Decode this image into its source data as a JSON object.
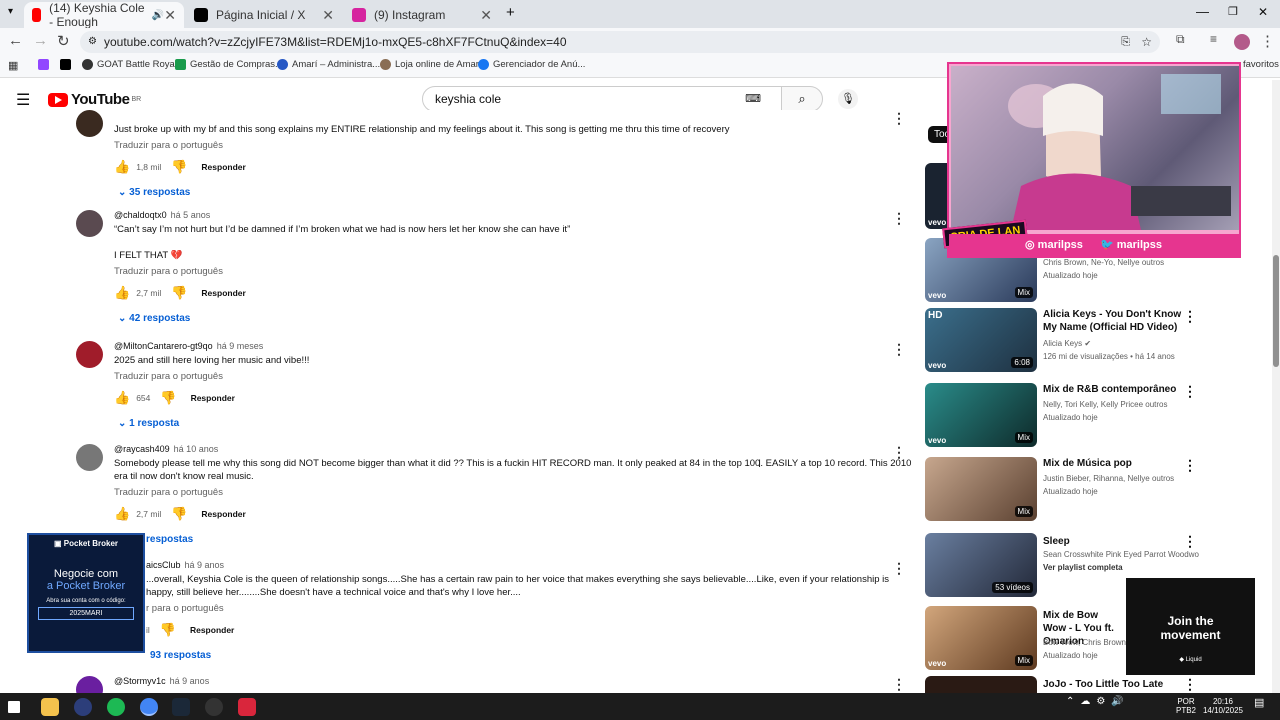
{
  "tabs": [
    {
      "title": "(14) Keyshia Cole - Enough",
      "color": "#ff0000"
    },
    {
      "title": "Página Inicial / X",
      "color": "#000000"
    },
    {
      "title": "(9) Instagram",
      "color": "#d6249f"
    }
  ],
  "address": "youtube.com/watch?v=zZcjyIFE73M&list=RDEMj1o-mxQE5-c8hXF7FCtnuQ&index=40",
  "bookmarks": [
    "GOAT Battle Royale",
    "Gestão de Compras...",
    "Amarí – Administra...",
    "Loja online de Amari",
    "Gerenciador de Anú..."
  ],
  "bookmarks_more": "favoritos",
  "yt": {
    "logo": "YouTube",
    "region": "BR",
    "search": "keyshia cole"
  },
  "comments": [
    {
      "text": "Just broke up with my bf and this song explains my ENTIRE relationship and my feelings about it. This song is getting me thru this time of recovery",
      "translate": "Traduzir para o português",
      "likes": "1,8 mil",
      "reply": "Responder",
      "replies": "35 respostas"
    },
    {
      "author": "@chaldoqtx0",
      "time": "há 5 anos",
      "text": "“Can’t say I’m not hurt but I’d be damned if I’m broken what we had is now hers let her know she can have it”",
      "text2": "I FELT THAT 💔",
      "translate": "Traduzir para o português",
      "likes": "2,7 mil",
      "reply": "Responder",
      "replies": "42 respostas"
    },
    {
      "author": "@MiltonCantarero-gt9qo",
      "time": "há 9 meses",
      "text": "2025 and still here loving her music and vibe!!!",
      "translate": "Traduzir para o português",
      "likes": "654",
      "reply": "Responder",
      "replies": "1 resposta"
    },
    {
      "author": "@raycash409",
      "time": "há 10 anos",
      "text": "Somebody please tell me why this song did NOT become bigger than what it did ?? This is a fuckin HIT RECORD man. It only peaked at 84 in the top 100. EASILY a top 10 record. This 2010 era til now don't know real music.",
      "translate": "Traduzir para o português",
      "likes": "2,7 mil",
      "reply": "Responder",
      "replies": "respostas"
    },
    {
      "author": "aicsClub",
      "time": "há 9 anos",
      "text": "...overall, Keyshia Cole is the queen of relationship songs.....She has a certain raw pain to her voice that makes everything she says believable....Like, even if your relationship is happy, still believe her........She doesn't have a technical voice and that's why I love her....",
      "translate": "r para o português",
      "likes": "il",
      "reply": "Responder",
      "replies": "93 respostas"
    },
    {
      "author": "@Stormyv1c",
      "time": "há 9 anos"
    }
  ],
  "sidebar": [
    {
      "title": "",
      "sub1": "Chris Brown, Ne-Yo, Nellye outros",
      "sub2": "Atualizado hoje",
      "badge": "Mix"
    },
    {
      "title": "Alicia Keys - You Don't Know My Name (Official HD Video)",
      "sub1": "Alicia Keys",
      "sub2": "126 mi de visualizações • há 14 anos",
      "badge": "6:08",
      "hd": "HD"
    },
    {
      "title": "Mix de R&B contemporâneo",
      "sub1": "Nelly, Tori Kelly, Kelly Pricee outros",
      "sub2": "Atualizado hoje",
      "badge": "Mix"
    },
    {
      "title": "Mix de Música pop",
      "sub1": "Justin Bieber, Rihanna, Nellye outros",
      "sub2": "Atualizado hoje",
      "badge": "Mix"
    },
    {
      "title": "Sleep",
      "sub1": "Sean Crosswhite Pink Eyed Parrot Woodwo",
      "sub2": "Ver playlist completa",
      "badge": "53 vídeos"
    },
    {
      "title": "Mix de Bow Wow - L You ft. Omarion",
      "sub1": "Bow Wow, Chris Brown,",
      "sub2": "Atualizado hoje",
      "badge": "Mix"
    },
    {
      "title": "JoJo - Too Little Too Late",
      "sub1": "",
      "sub2": ""
    }
  ],
  "sidebar_top_label": "Too",
  "overlay": {
    "instagram": "marilpss",
    "twitter": "marilpss",
    "logo": "CRIA DE LAN"
  },
  "ad": {
    "brand": "Pocket Broker",
    "line1": "Negocie com",
    "line2": "a Pocket Broker",
    "line3": "Abra sua conta com o código:",
    "code": "2025MARI"
  },
  "promo": {
    "line1": "Join the",
    "line2": "movement",
    "brand": "Liquid"
  },
  "tray": {
    "lang": "POR",
    "layout": "PTB2",
    "time": "20:16",
    "date": "14/10/2025"
  }
}
